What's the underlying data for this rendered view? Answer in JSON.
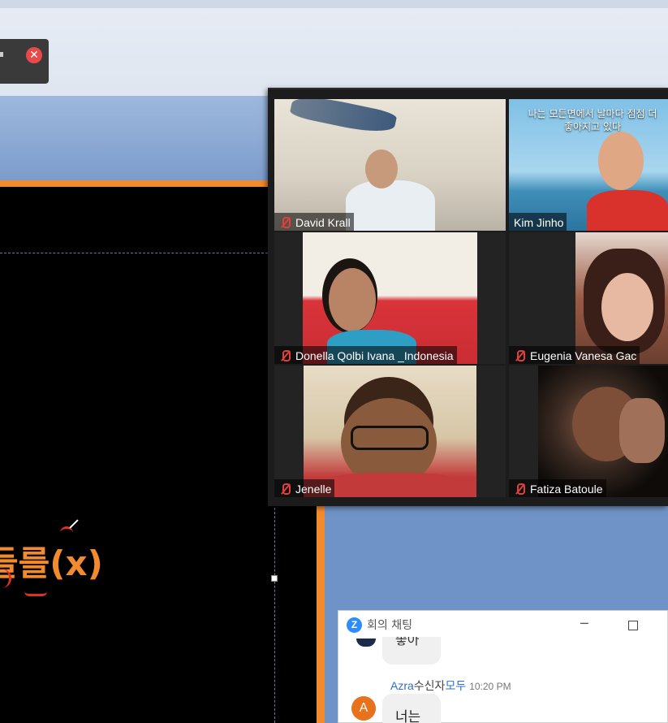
{
  "slide": {
    "text_main": "들를",
    "text_suffix": "(x)"
  },
  "gallery": {
    "participants": [
      {
        "name": "David Krall"
      },
      {
        "name": "Kim Jinho",
        "overlay_text": "나는 모든면에서 날마다 점점 더 좋아지고 있다"
      },
      {
        "name": "Donella Qolbi Ivana _Indonesia"
      },
      {
        "name": "Eugenia Vanesa Gac"
      },
      {
        "name": "Jenelle"
      },
      {
        "name": "Fatiza Batoule"
      }
    ]
  },
  "chat": {
    "title": "회의 채팅",
    "zoom_logo": "Z",
    "minimize_glyph": "─",
    "previous_message": "좋아",
    "message": {
      "sender": "Azra",
      "to_label": "수신자",
      "recipient": "모두",
      "time": "10:20 PM",
      "avatar_letter": "A",
      "text": "너는"
    }
  },
  "notification": {
    "close_glyph": "✕"
  },
  "colors": {
    "slide_accent": "#f28a2e",
    "mic_muted": "#e0403a",
    "chat_link": "#2d6fd0",
    "avatar": "#e8711c"
  }
}
